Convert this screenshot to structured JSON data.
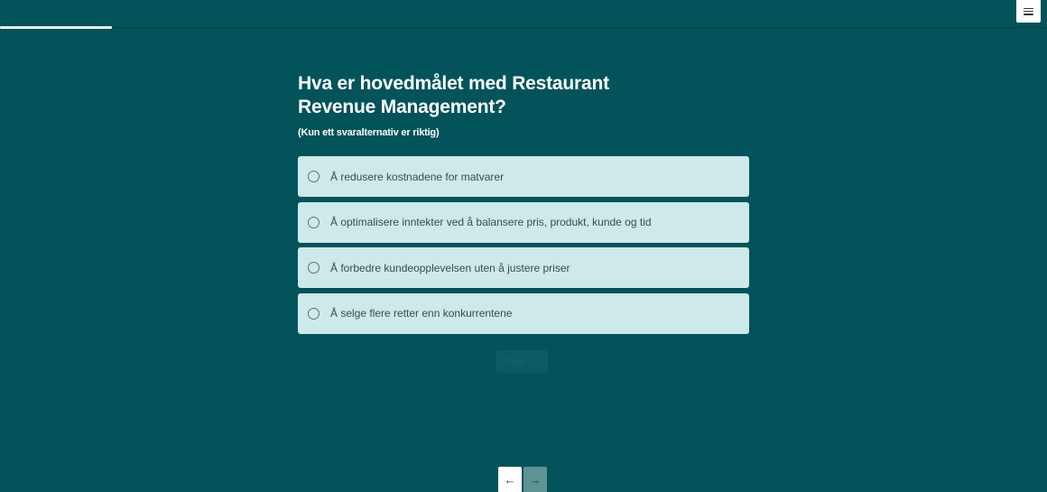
{
  "progress": {
    "fraction": 0.107
  },
  "menu": {
    "icon": "hamburger-icon"
  },
  "question": {
    "title": "Hva er hovedmålet med Restaurant Revenue Management?",
    "hint": "(Kun ett svaralternativ er riktig)",
    "options": [
      {
        "label": "Å redusere kostnadene for matvarer"
      },
      {
        "label": "Å optimalisere inntekter ved å balansere pris, produkt, kunde og tid"
      },
      {
        "label": "Å forbedre kundeopplevelsen uten å justere priser"
      },
      {
        "label": "Å selge flere retter enn konkurrentene"
      }
    ]
  },
  "submit": {
    "label": "Svar",
    "icon": "check-circle-icon"
  },
  "nav": {
    "prev_icon": "arrow-left-icon",
    "next_icon": "arrow-right-icon",
    "prev_glyph": "←",
    "next_glyph": "→"
  },
  "colors": {
    "background": "#02535a",
    "option_bg": "#cde9e9",
    "progress_fill": "#e9f3f3"
  }
}
